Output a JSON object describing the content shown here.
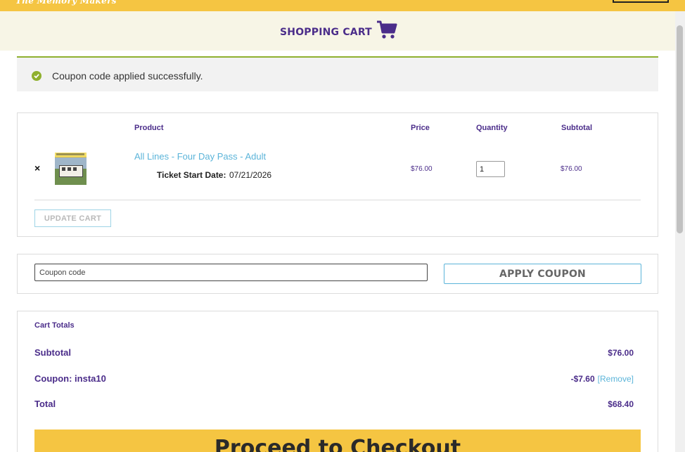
{
  "site": {
    "brand": "The Memory Makers"
  },
  "header": {
    "title": "SHOPPING CART",
    "cart_icon": "shopping-cart-icon"
  },
  "notice": {
    "message": "Coupon code applied successfully.",
    "icon": "check-circle-icon",
    "color": "#8fb02e"
  },
  "cart_table": {
    "columns": {
      "product": "Product",
      "price": "Price",
      "quantity": "Quantity",
      "subtotal": "Subtotal"
    },
    "items": [
      {
        "remove": "×",
        "thumbnail": "trolley-photo",
        "name": "All Lines - Four Day Pass - Adult",
        "meta_label": "Ticket Start Date:",
        "meta_value": "07/21/2026",
        "price": "$76.00",
        "quantity": "1",
        "subtotal": "$76.00"
      }
    ],
    "update_button": "UPDATE CART"
  },
  "coupon": {
    "placeholder": "Coupon code",
    "apply_button": "APPLY COUPON"
  },
  "totals": {
    "title": "Cart Totals",
    "subtotal_label": "Subtotal",
    "subtotal_value": "$76.00",
    "coupon_label": "Coupon: insta10",
    "coupon_value": "-$7.60",
    "coupon_remove": "[Remove]",
    "total_label": "Total",
    "total_value": "$68.40",
    "checkout_button": "Proceed to Checkout"
  },
  "colors": {
    "accent_yellow": "#f5c542",
    "brand_purple": "#4b2d8a",
    "link_blue": "#5bb4d9"
  }
}
